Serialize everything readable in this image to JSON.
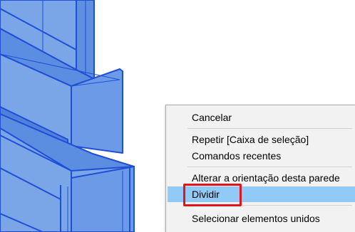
{
  "context_menu": {
    "items": [
      {
        "label": "Cancelar"
      },
      {
        "label": "Repetir [Caixa de seleção]"
      },
      {
        "label": "Comandos recentes"
      },
      {
        "label": "Alterar a orientação desta parede"
      },
      {
        "label": "Dividir",
        "highlighted": true
      },
      {
        "label": "Selecionar elementos unidos"
      }
    ]
  },
  "colors": {
    "wall_fill": "#6f9fe6",
    "wall_edge": "#1f4fd6",
    "menu_bg": "#f2f2f2",
    "highlight": "#91c9f7",
    "annotation_box": "#e0151b"
  }
}
